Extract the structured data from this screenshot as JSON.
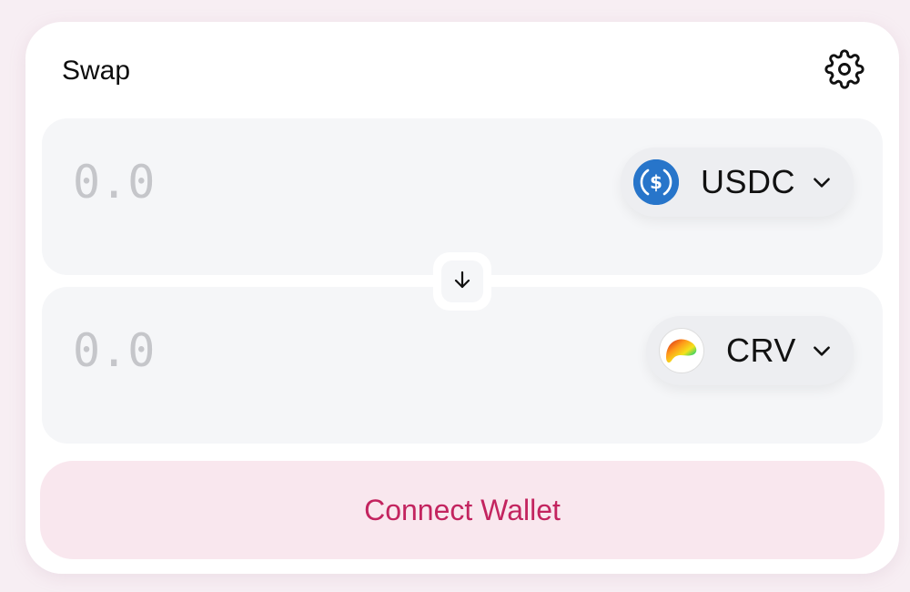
{
  "header": {
    "title": "Swap",
    "settings_icon": "gear-icon"
  },
  "sell": {
    "placeholder": "0.0",
    "token": {
      "symbol": "USDC",
      "icon": "usdc-logo-icon",
      "color": "#2775ca"
    }
  },
  "buy": {
    "placeholder": "0.0",
    "token": {
      "symbol": "CRV",
      "icon": "crv-logo-icon"
    }
  },
  "switch": {
    "icon": "arrow-down-icon"
  },
  "connect_button": {
    "label": "Connect Wallet",
    "text_color": "#c3245f",
    "background": "#f9e7ee"
  }
}
